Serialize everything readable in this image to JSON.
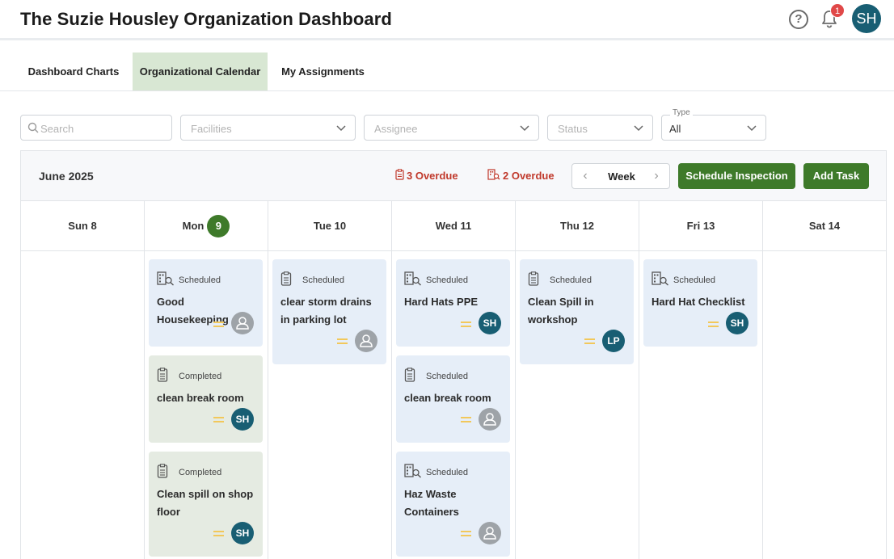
{
  "header": {
    "title": "The Suzie Housley Organization Dashboard",
    "help_symbol": "?",
    "notification_count": "1",
    "user_initials": "SH"
  },
  "tabs": [
    {
      "label": "Dashboard Charts",
      "active": false
    },
    {
      "label": "Organizational Calendar",
      "active": true
    },
    {
      "label": "My Assignments",
      "active": false
    }
  ],
  "filters": {
    "search_placeholder": "Search",
    "facilities_placeholder": "Facilities",
    "assignee_placeholder": "Assignee",
    "status_placeholder": "Status",
    "type_label": "Type",
    "type_value": "All"
  },
  "calendar": {
    "month": "June 2025",
    "overdue_tasks": "3 Overdue",
    "overdue_inspections": "2 Overdue",
    "view_label": "Week",
    "prev_symbol": "‹",
    "next_symbol": "›",
    "schedule_inspection_label": "Schedule Inspection",
    "add_task_label": "Add Task",
    "days": [
      {
        "name": "Sun",
        "date": "8",
        "today": false
      },
      {
        "name": "Mon",
        "date": "9",
        "today": true
      },
      {
        "name": "Tue",
        "date": "10",
        "today": false
      },
      {
        "name": "Wed",
        "date": "11",
        "today": false
      },
      {
        "name": "Thu",
        "date": "12",
        "today": false
      },
      {
        "name": "Fri",
        "date": "13",
        "today": false
      },
      {
        "name": "Sat",
        "date": "14",
        "today": false
      }
    ],
    "day_labels": [
      "Sun 8",
      "Mon",
      "Tue 10",
      "Wed 11",
      "Thu 12",
      "Fri 13",
      "Sat 14"
    ],
    "events": {
      "mon": [
        {
          "kind": "inspection",
          "status": "Scheduled",
          "title": "Good Housekeeping",
          "assignee": ""
        },
        {
          "kind": "task",
          "status": "Completed",
          "title": "clean break room",
          "assignee": "SH"
        },
        {
          "kind": "task",
          "status": "Completed",
          "title": "Clean spill on shop floor",
          "assignee": "SH"
        }
      ],
      "tue": [
        {
          "kind": "task",
          "status": "Scheduled",
          "title": "clear storm drains in parking lot",
          "assignee": ""
        }
      ],
      "wed": [
        {
          "kind": "inspection",
          "status": "Scheduled",
          "title": "Hard Hats PPE",
          "assignee": "SH"
        },
        {
          "kind": "task",
          "status": "Scheduled",
          "title": "clean break room",
          "assignee": ""
        },
        {
          "kind": "inspection",
          "status": "Scheduled",
          "title": "Haz Waste Containers",
          "assignee": ""
        }
      ],
      "thu": [
        {
          "kind": "task",
          "status": "Scheduled",
          "title": "Clean Spill in workshop",
          "assignee": "LP"
        }
      ],
      "fri": [
        {
          "kind": "inspection",
          "status": "Scheduled",
          "title": "Hard Hat Checklist",
          "assignee": "SH"
        }
      ]
    }
  },
  "colors": {
    "brand_green": "#3e7a2a",
    "avatar_teal": "#185e73",
    "overdue_red": "#c0392b",
    "scheduled_card": "#e6eef8",
    "completed_card": "#e5ebe2"
  }
}
